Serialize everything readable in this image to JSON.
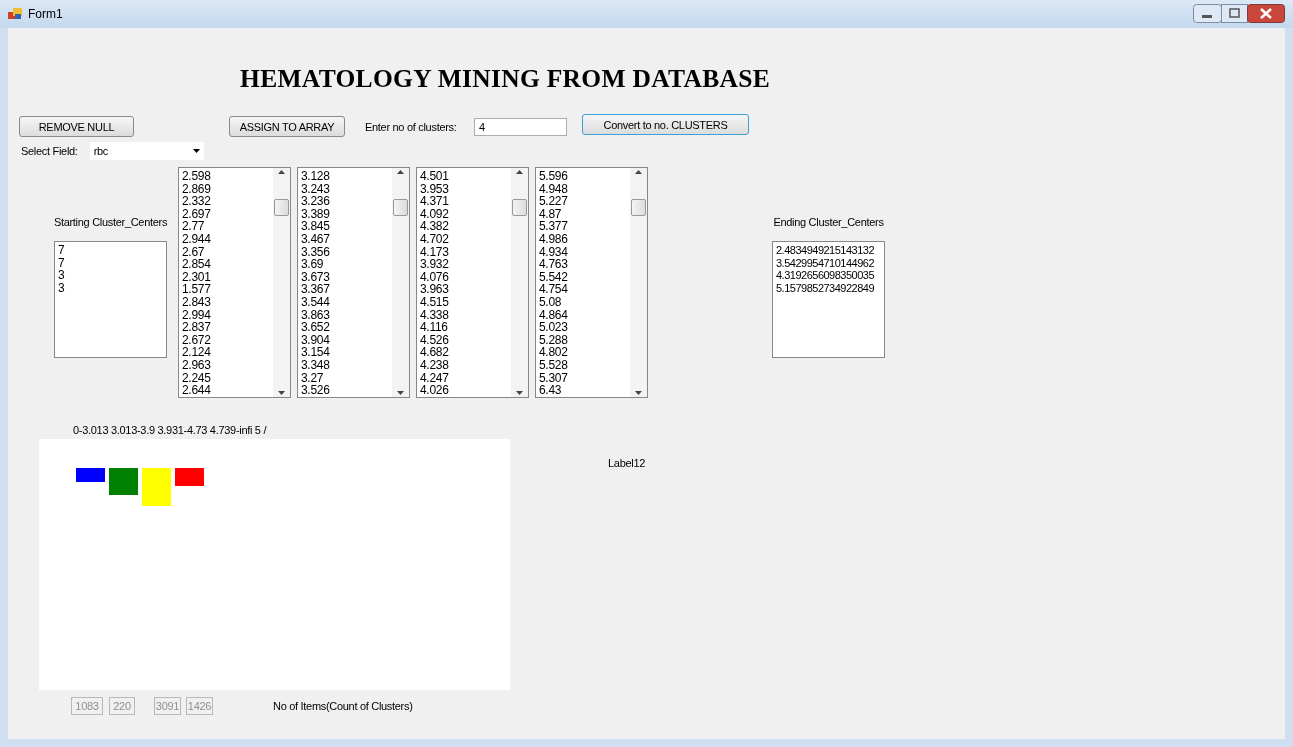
{
  "window": {
    "title": "Form1"
  },
  "heading": "HEMATOLOGY MINING FROM DATABASE",
  "toolbar": {
    "remove_button": "REMOVE NULL",
    "assign_button": "ASSIGN TO ARRAY",
    "clusters_label": "Enter no of clusters:",
    "clusters_value": "4",
    "convert_button": "Convert to no. CLUSTERS"
  },
  "field_select": {
    "label": "Select Field:",
    "value": "rbc"
  },
  "starting_centers": {
    "label": "Starting Cluster_Centers",
    "items": [
      "7",
      "7",
      "3",
      "3"
    ]
  },
  "data_lists": [
    [
      "2.598",
      "2.869",
      "2.332",
      "2.697",
      "2.77",
      "2.944",
      "2.67",
      "2.854",
      "2.301",
      "1.577",
      "2.843",
      "2.994",
      "2.837",
      "2.672",
      "2.124",
      "2.963",
      "2.245",
      "2.644"
    ],
    [
      "3.128",
      "3.243",
      "3.236",
      "3.389",
      "3.845",
      "3.467",
      "3.356",
      "3.69",
      "3.673",
      "3.367",
      "3.544",
      "3.863",
      "3.652",
      "3.904",
      "3.154",
      "3.348",
      "3.27",
      "3.526"
    ],
    [
      "4.501",
      "3.953",
      "4.371",
      "4.092",
      "4.382",
      "4.702",
      "4.173",
      "3.932",
      "4.076",
      "3.963",
      "4.515",
      "4.338",
      "4.116",
      "4.526",
      "4.682",
      "4.238",
      "4.247",
      "4.026"
    ],
    [
      "5.596",
      "4.948",
      "5.227",
      "4.87",
      "5.377",
      "4.986",
      "4.934",
      "4.763",
      "5.542",
      "4.754",
      "5.08",
      "4.864",
      "5.023",
      "5.288",
      "4.802",
      "5.528",
      "5.307",
      "6.43"
    ]
  ],
  "ending_centers": {
    "label": "Ending Cluster_Centers",
    "items": [
      "2.4834949215143132",
      "3.5429954710144962",
      "4.3192656098350035",
      "5.1579852734922849"
    ]
  },
  "ranges_label": "0-3.013 3.013-3.9 3.931-4.73 4.739-infi 5 /",
  "chart_panel": {
    "bars": [
      {
        "color": "#0000ff"
      },
      {
        "color": "#008000"
      },
      {
        "color": "#ffff00"
      },
      {
        "color": "#ff0000"
      }
    ]
  },
  "status_label": "Label12",
  "counts": {
    "values": [
      "1083",
      "220",
      "3091",
      "1426"
    ],
    "label": "No of Items(Count of Clusters)"
  }
}
